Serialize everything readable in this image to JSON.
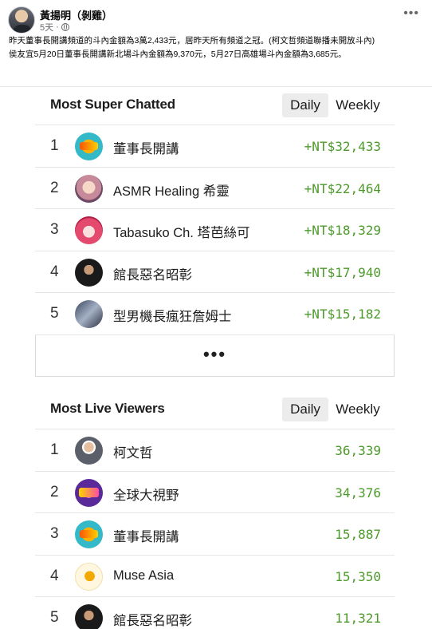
{
  "post": {
    "author": "黃揚明（剝雞）",
    "time": "5天",
    "sep": "·",
    "paragraph1": "昨天董事長開講頻道的斗內金額為3萬2,433元，居昨天所有頻道之冠。(柯文哲頻道聯播未開放斗內)",
    "paragraph2": "侯友宜5月20日董事長開講新北場斗內金額為9,370元，5月27日高雄場斗內金額為3,685元。"
  },
  "super_chatted": {
    "title": "Most Super Chatted",
    "tab_daily": "Daily",
    "tab_weekly": "Weekly",
    "rows": [
      {
        "rank": "1",
        "name": "董事長開講",
        "value": "+NT$32,433"
      },
      {
        "rank": "2",
        "name": "ASMR Healing 希靈",
        "value": "+NT$22,464"
      },
      {
        "rank": "3",
        "name": "Tabasuko Ch. 塔芭絲可",
        "value": "+NT$18,329"
      },
      {
        "rank": "4",
        "name": "館長惡名昭彰",
        "value": "+NT$17,940"
      },
      {
        "rank": "5",
        "name": "型男機長瘋狂詹姆士",
        "value": "+NT$15,182"
      }
    ],
    "more": "•••"
  },
  "live_viewers": {
    "title": "Most Live Viewers",
    "tab_daily": "Daily",
    "tab_weekly": "Weekly",
    "rows": [
      {
        "rank": "1",
        "name": "柯文哲",
        "value": "36,339"
      },
      {
        "rank": "2",
        "name": "全球大視野",
        "value": "34,376"
      },
      {
        "rank": "3",
        "name": "董事長開講",
        "value": "15,887"
      },
      {
        "rank": "4",
        "name": "Muse Asia",
        "value": "15,350"
      },
      {
        "rank": "5",
        "name": "館長惡名昭彰",
        "value": "11,321"
      }
    ]
  },
  "colors": {
    "positive_amount": "#4c9a2a",
    "active_tab_bg": "#ececec"
  }
}
